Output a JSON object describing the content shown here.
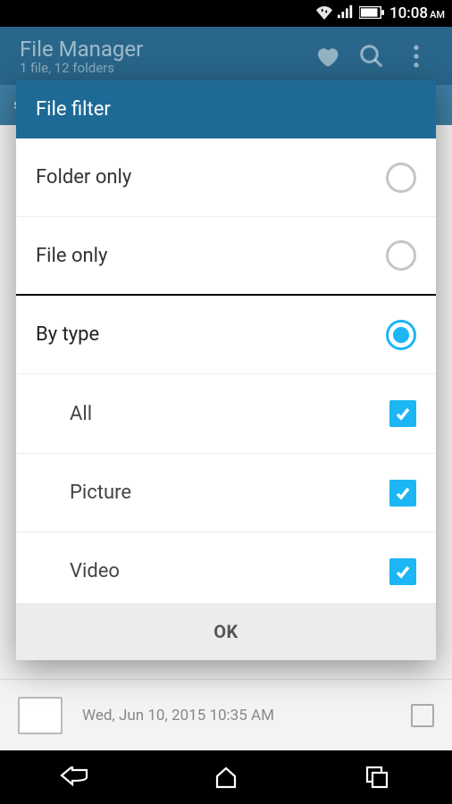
{
  "status": {
    "time": "10:08",
    "ampm": "AM"
  },
  "header": {
    "title": "File Manager",
    "subtitle": "1 file, 12 folders"
  },
  "bg_item": {
    "date": "Wed, Jun 10, 2015 10:35 AM"
  },
  "dialog": {
    "title": "File filter",
    "options": {
      "folder_only": "Folder only",
      "file_only": "File only",
      "by_type": "By type"
    },
    "types": {
      "all": "All",
      "picture": "Picture",
      "video": "Video"
    },
    "ok": "OK"
  }
}
